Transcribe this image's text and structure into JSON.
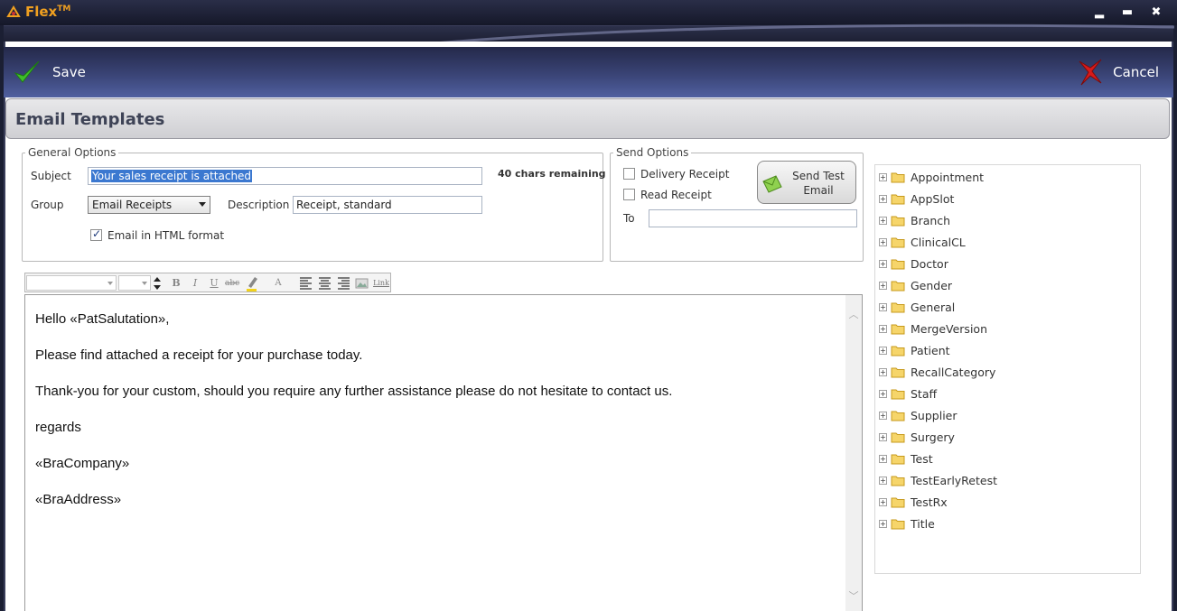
{
  "app": {
    "title": "Flex",
    "tm": "TM"
  },
  "window_controls": {
    "minimize": "▂",
    "maximize": "▬",
    "close": "✖"
  },
  "toolbar": {
    "save_label": "Save",
    "cancel_label": "Cancel"
  },
  "page_title": "Email Templates",
  "general_options": {
    "legend": "General Options",
    "subject_label": "Subject",
    "subject_value": "Your sales receipt is attached",
    "chars_remaining": "40 chars remaining",
    "group_label": "Group",
    "group_value": "Email Receipts",
    "description_label": "Description",
    "description_value": "Receipt, standard",
    "html_format_label": "Email in HTML format",
    "html_format_checked": true
  },
  "send_options": {
    "legend": "Send Options",
    "delivery_receipt_label": "Delivery Receipt",
    "read_receipt_label": "Read Receipt",
    "to_label": "To",
    "to_value": "",
    "send_test_line1": "Send Test",
    "send_test_line2": "Email"
  },
  "format_toolbar": {
    "bold": "B",
    "italic": "I",
    "underline": "U",
    "strike": "abc",
    "font_color": "A",
    "link": "Link"
  },
  "editor": {
    "lines": [
      "Hello «PatSalutation»,",
      "Please find attached a receipt for your purchase today.",
      "Thank-you for your custom, should you require any further assistance please do not hesitate to contact us.",
      "regards",
      "«BraCompany»",
      "«BraAddress»"
    ]
  },
  "tree": {
    "items": [
      "Appointment",
      "AppSlot",
      "Branch",
      "ClinicalCL",
      "Doctor",
      "Gender",
      "General",
      "MergeVersion",
      "Patient",
      "RecallCategory",
      "Staff",
      "Supplier",
      "Surgery",
      "Test",
      "TestEarlyRetest",
      "TestRx",
      "Title"
    ]
  },
  "colors": {
    "accent_orange": "#f0a020",
    "selection": "#3b78d0",
    "folder": "#f2c94c"
  }
}
